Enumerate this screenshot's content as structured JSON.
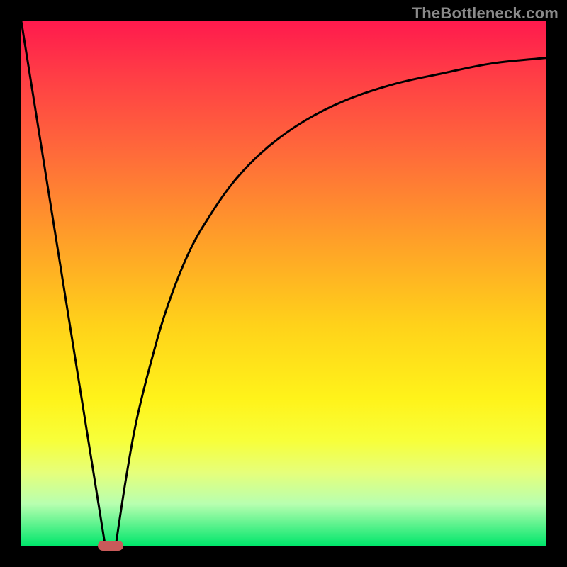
{
  "watermark": "TheBottleneck.com",
  "chart_data": {
    "type": "line",
    "title": "",
    "xlabel": "",
    "ylabel": "",
    "xlim": [
      0,
      100
    ],
    "ylim": [
      0,
      100
    ],
    "grid": false,
    "legend": false,
    "series": [
      {
        "name": "left-line",
        "x": [
          0,
          16
        ],
        "y": [
          100,
          0
        ]
      },
      {
        "name": "right-curve",
        "x": [
          18,
          20,
          22,
          25,
          28,
          32,
          36,
          41,
          47,
          54,
          62,
          71,
          80,
          90,
          100
        ],
        "y": [
          0,
          13,
          24,
          36,
          46,
          56,
          63,
          70,
          76,
          81,
          85,
          88,
          90,
          92,
          93
        ]
      }
    ],
    "marker": {
      "x": 17,
      "y": 0,
      "color": "#c95a5a"
    },
    "gradient_stops": [
      {
        "pos": 0,
        "color": "#ff1a4d"
      },
      {
        "pos": 10,
        "color": "#ff3c46"
      },
      {
        "pos": 25,
        "color": "#ff6a3a"
      },
      {
        "pos": 42,
        "color": "#ffa028"
      },
      {
        "pos": 58,
        "color": "#ffd21a"
      },
      {
        "pos": 72,
        "color": "#fff31a"
      },
      {
        "pos": 80,
        "color": "#f7ff3a"
      },
      {
        "pos": 86,
        "color": "#e6ff7a"
      },
      {
        "pos": 92,
        "color": "#b8ffb0"
      },
      {
        "pos": 100,
        "color": "#00e66b"
      }
    ]
  }
}
